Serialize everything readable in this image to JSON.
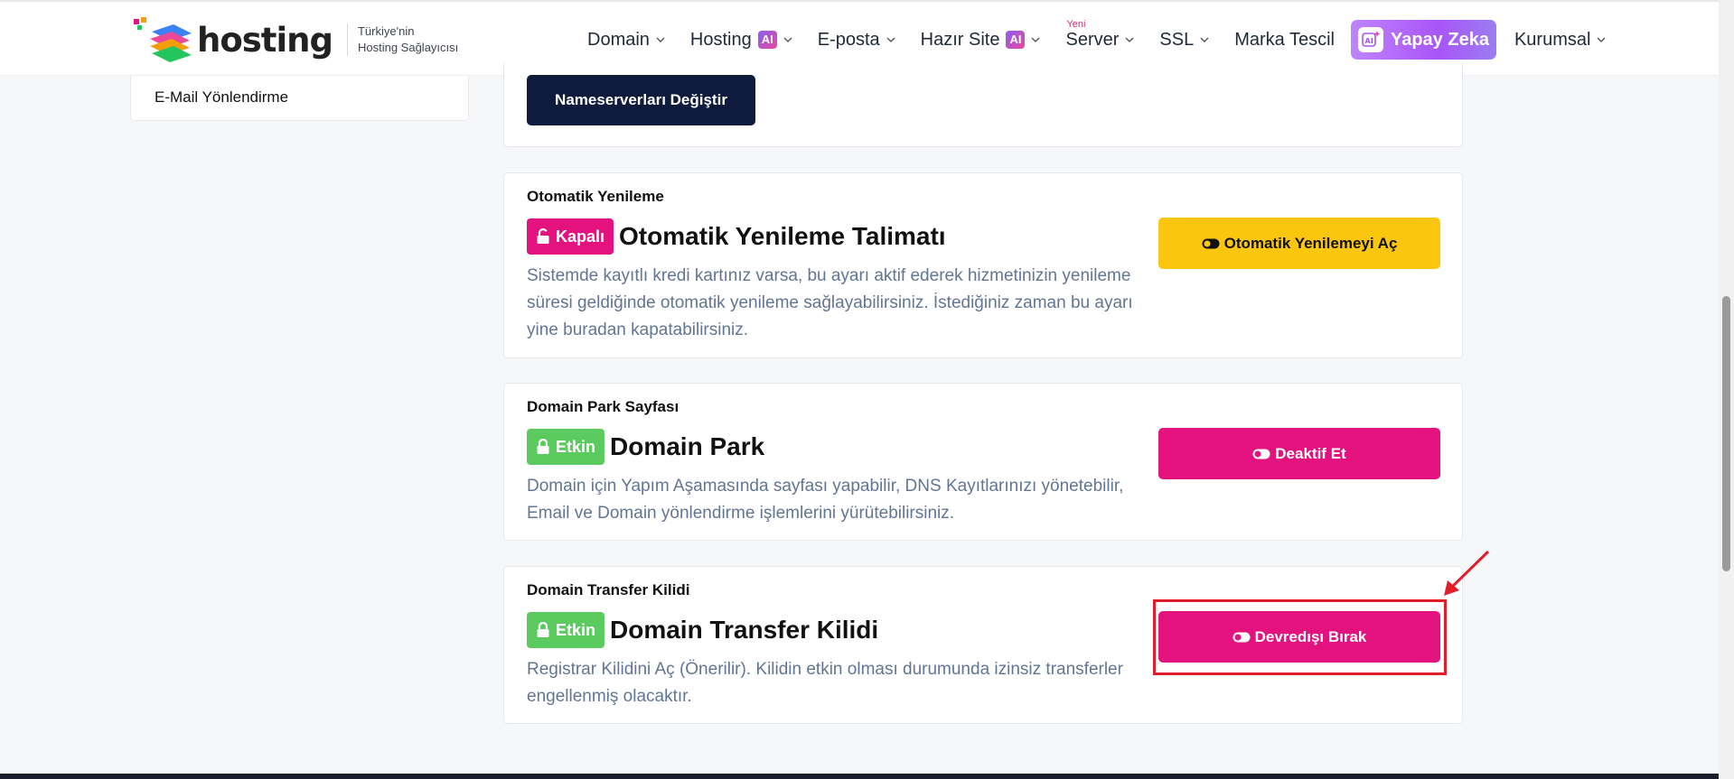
{
  "logo": {
    "word": "hosting",
    "tagline_line1": "Türkiye'nin",
    "tagline_line2": "Hosting Sağlayıcısı"
  },
  "nav": {
    "items": [
      {
        "label": "Domain",
        "has_dropdown": true
      },
      {
        "label": "Hosting",
        "badge": "AI",
        "has_dropdown": true
      },
      {
        "label": "E-posta",
        "has_dropdown": true
      },
      {
        "label": "Hazır Site",
        "badge": "AI",
        "has_dropdown": true
      },
      {
        "label": "Server",
        "tag": "Yeni",
        "has_dropdown": true
      },
      {
        "label": "SSL",
        "has_dropdown": true
      },
      {
        "label": "Marka Tescil",
        "has_dropdown": false
      },
      {
        "label": "Yapay Zeka",
        "highlight": true,
        "icon": "ai-sparkle-icon"
      },
      {
        "label": "Kurumsal",
        "has_dropdown": true
      }
    ]
  },
  "sidebar": {
    "last_item": "E-Mail Yönlendirme"
  },
  "nameservers": {
    "button_label": "Nameserverları Değiştir"
  },
  "auto_renew": {
    "section_label": "Otomatik Yenileme",
    "status": "Kapalı",
    "status_icon": "unlock-icon",
    "title": "Otomatik Yenileme Talimatı",
    "description": "Sistemde kayıtlı kredi kartınız varsa, bu ayarı aktif ederek hizmetinizin yenileme süresi geldiğinde otomatik yenileme sağlayabilirsiniz. İstediğiniz zaman bu ayarı yine buradan kapatabilirsiniz.",
    "button_label": "Otomatik Yenilemeyi Aç",
    "button_icon": "toggle-icon"
  },
  "domain_park": {
    "section_label": "Domain Park Sayfası",
    "status": "Etkin",
    "status_icon": "lock-icon",
    "title": "Domain Park",
    "description": "Domain için Yapım Aşamasında sayfası yapabilir, DNS Kayıtlarınızı yönetebilir, Email ve Domain yönlendirme işlemlerini yürütebilirsiniz.",
    "button_label": "Deaktif Et",
    "button_icon": "toggle-icon"
  },
  "transfer_lock": {
    "section_label": "Domain Transfer Kilidi",
    "status": "Etkin",
    "status_icon": "lock-icon",
    "title": "Domain Transfer Kilidi",
    "description": "Registrar Kilidini Aç (Önerilir). Kilidin etkin olması durumunda izinsiz transferler engellenmiş olacaktır.",
    "button_label": "Devredışı Bırak",
    "button_icon": "toggle-icon"
  },
  "colors": {
    "brand_pink": "#e3127e",
    "brand_yellow": "#fbc70e",
    "status_green": "#5ccb5f",
    "navy": "#0f1b3d",
    "annotation_red": "#e11d2a"
  }
}
